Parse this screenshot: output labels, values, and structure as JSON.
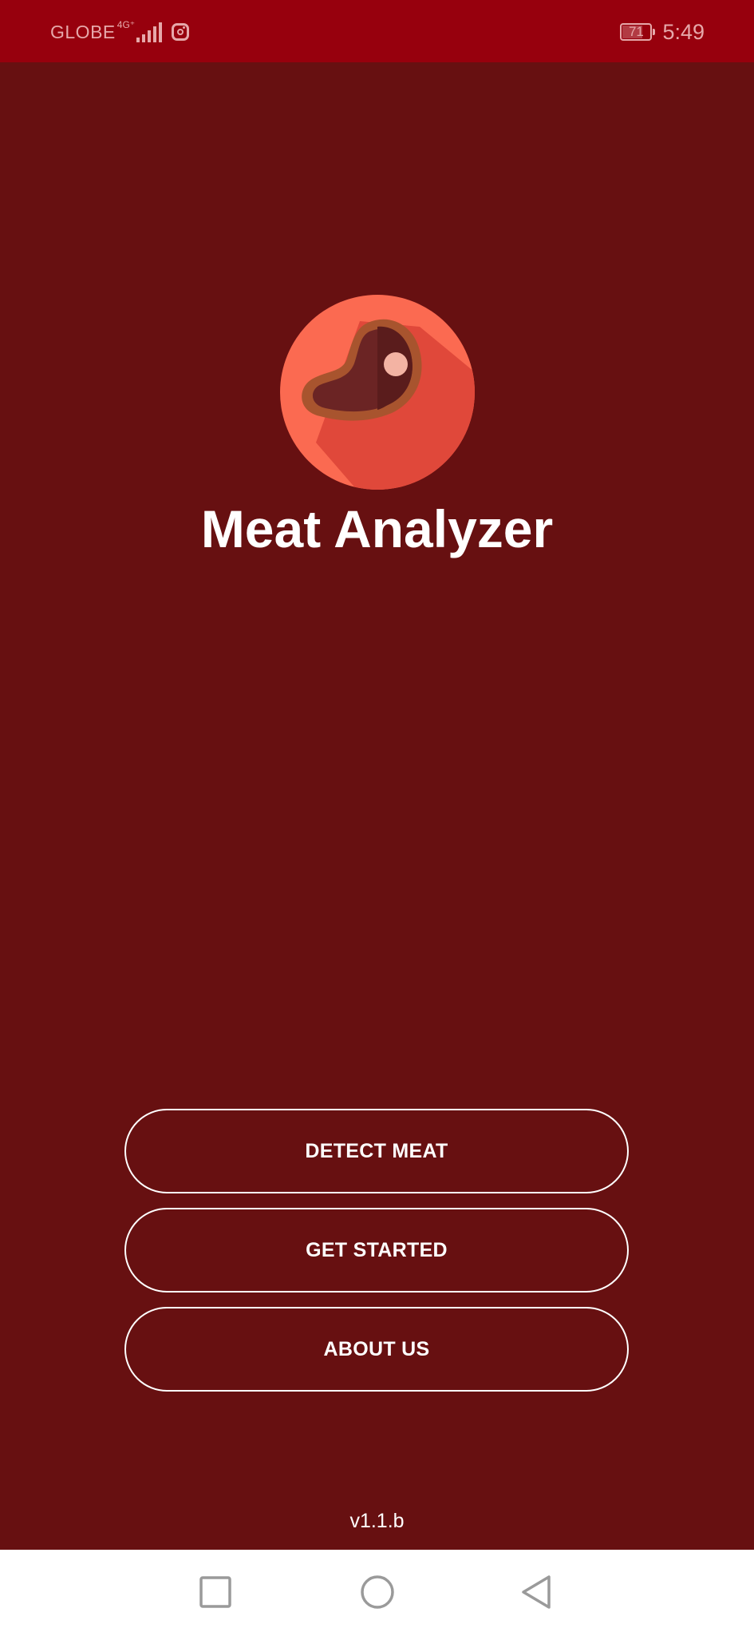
{
  "status_bar": {
    "carrier": "GLOBE",
    "network_type": "4G⁺",
    "battery_level": "71",
    "time": "5:49",
    "icons": [
      "signal-icon",
      "instagram-icon",
      "battery-icon"
    ]
  },
  "app": {
    "title": "Meat Analyzer",
    "logo_icon": "meat-steak-icon",
    "version": "v1.1.b"
  },
  "menu": {
    "detect_label": "DETECT MEAT",
    "started_label": "GET STARTED",
    "about_label": "ABOUT US"
  },
  "nav_bar": {
    "buttons": [
      "recents-icon",
      "home-icon",
      "back-icon"
    ]
  },
  "colors": {
    "background": "#671011",
    "status_bar": "#97000d",
    "logo_circle": "#fb6a51",
    "logo_shadow": "#e0483a",
    "meat": "#6b2424",
    "meat_rim": "#a8542e",
    "button_border": "#ffffff"
  }
}
